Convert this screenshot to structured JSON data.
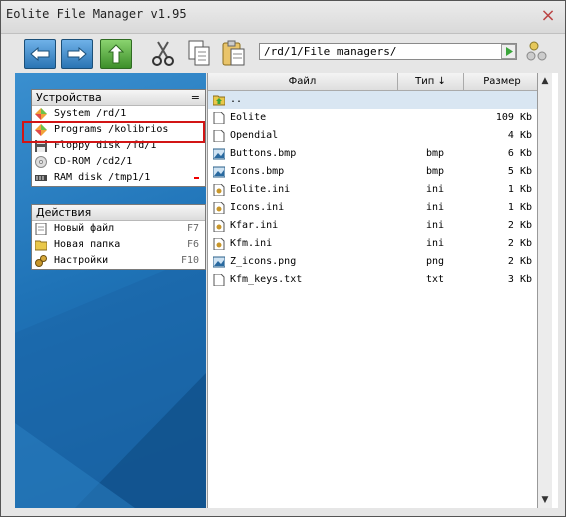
{
  "window": {
    "title": "Eolite File Manager v1.95"
  },
  "toolbar": {
    "back": "back-arrow-icon",
    "forward": "forward-arrow-icon",
    "up": "up-arrow-icon",
    "cut": "scissors-icon",
    "copy": "copy-icon",
    "paste": "paste-icon"
  },
  "path": {
    "value": "/rd/1/File managers/"
  },
  "devices": {
    "header": "Устройства",
    "collapse": "=",
    "items": [
      {
        "label": "System /rd/1",
        "icon": "diamond-icon"
      },
      {
        "label": "Programs /kolibrios",
        "icon": "diamond-icon"
      },
      {
        "label": "Floppy disk /fd/1",
        "icon": "floppy-icon"
      },
      {
        "label": "CD-ROM /cd2/1",
        "icon": "cdrom-icon"
      },
      {
        "label": "RAM disk /tmp1/1",
        "icon": "ram-icon"
      }
    ]
  },
  "actions": {
    "header": "Действия",
    "items": [
      {
        "label": "Новый файл",
        "key": "F7"
      },
      {
        "label": "Новая папка",
        "key": "F6"
      },
      {
        "label": "Настройки",
        "key": "F10"
      }
    ]
  },
  "files": {
    "columns": {
      "name": "Файл",
      "type": "Тип ↓",
      "size": "Размер"
    },
    "rows": [
      {
        "name": "..",
        "type": "",
        "size": "",
        "kind": "up"
      },
      {
        "name": "Eolite",
        "type": "",
        "size": "109 Kb",
        "kind": "file"
      },
      {
        "name": "Opendial",
        "type": "",
        "size": "4 Kb",
        "kind": "file"
      },
      {
        "name": "Buttons.bmp",
        "type": "bmp",
        "size": "6 Kb",
        "kind": "image"
      },
      {
        "name": "Icons.bmp",
        "type": "bmp",
        "size": "5 Kb",
        "kind": "image"
      },
      {
        "name": "Eolite.ini",
        "type": "ini",
        "size": "1 Kb",
        "kind": "ini"
      },
      {
        "name": "Icons.ini",
        "type": "ini",
        "size": "1 Kb",
        "kind": "ini"
      },
      {
        "name": "Kfar.ini",
        "type": "ini",
        "size": "2 Kb",
        "kind": "ini"
      },
      {
        "name": "Kfm.ini",
        "type": "ini",
        "size": "2 Kb",
        "kind": "ini"
      },
      {
        "name": "Z_icons.png",
        "type": "png",
        "size": "2 Kb",
        "kind": "image"
      },
      {
        "name": "Kfm_keys.txt",
        "type": "txt",
        "size": "3 Kb",
        "kind": "file"
      }
    ]
  }
}
